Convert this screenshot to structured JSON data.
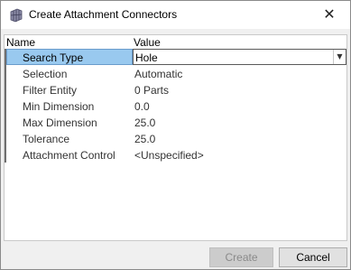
{
  "window": {
    "title": "Create Attachment Connectors",
    "close_glyph": "✕",
    "icon": "attachment-connectors-icon"
  },
  "grid": {
    "columns": [
      "Name",
      "Value"
    ],
    "rows": [
      {
        "name": "Search Type",
        "value": "Hole",
        "selected": true,
        "control": "dropdown"
      },
      {
        "name": "Selection",
        "value": "Automatic"
      },
      {
        "name": "Filter Entity",
        "value": "0 Parts"
      },
      {
        "name": "Min Dimension",
        "value": "0.0"
      },
      {
        "name": "Max Dimension",
        "value": "25.0"
      },
      {
        "name": "Tolerance",
        "value": "25.0"
      },
      {
        "name": "Attachment Control",
        "value": "<Unspecified>"
      }
    ],
    "dropdown_arrow": "▼"
  },
  "buttons": {
    "create_label": "Create",
    "create_enabled": false,
    "cancel_label": "Cancel"
  },
  "colors": {
    "selection": "#99c9ef",
    "window_bg": "#f0f0f0",
    "disabled_text": "#8a8a8a"
  }
}
